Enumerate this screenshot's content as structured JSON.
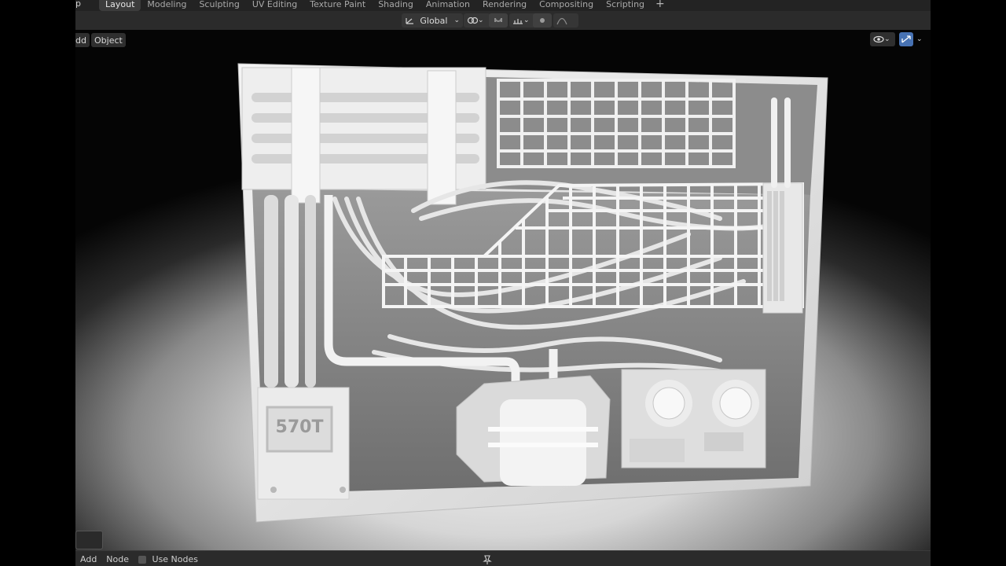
{
  "topbar": {
    "cut_label": "p",
    "tabs": [
      {
        "label": "Layout",
        "active": true
      },
      {
        "label": "Modeling"
      },
      {
        "label": "Sculpting"
      },
      {
        "label": "UV Editing"
      },
      {
        "label": "Texture Paint"
      },
      {
        "label": "Shading"
      },
      {
        "label": "Animation"
      },
      {
        "label": "Rendering"
      },
      {
        "label": "Compositing"
      },
      {
        "label": "Scripting"
      }
    ],
    "add_tab": "+"
  },
  "header": {
    "menu_add": "dd",
    "menu_object": "Object",
    "orientation": "Global"
  },
  "viewport": {
    "panel_label": "570T"
  },
  "bottombar": {
    "add": "Add",
    "node": "Node",
    "use_nodes": "Use Nodes"
  },
  "colors": {
    "active_tab": "#3c3c3c",
    "accent_blue": "#4772b3",
    "ui_bg": "#2b2b2b"
  }
}
